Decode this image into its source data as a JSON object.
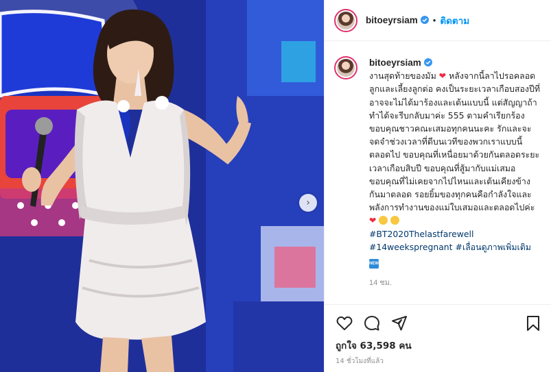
{
  "post": {
    "username": "bitoeyrsiam",
    "verified": true,
    "separator": "•",
    "follow_label": "ติดตาม"
  },
  "caption": {
    "username": "bitoeyrsiam",
    "text_1": "งานสุดท้ายของมัม",
    "heart": "❤",
    "text_2": "หลังจากนี้ลาไปรอคลอดลูกและเลี้ยงลูกต่อ คงเป็นระยะเวลาเกือบสองปีที่อาจจะไม่ได้มาร้องและเต้นแบบนี้ แต่สัญญาถ้าทำได้จะรีบกลับมาค่ะ 555 ตามคำเรียกร้อง ขอบคุณชาวคณะเสมอทุกคนนะคะ รักและจะจดจำช่วงเวลาที่ดีบนเวทีของพวกเราแบบนี้ตลอดไป ขอบคุณที่เหนื่อยมาด้วยกันตลอดระยะเวลาเกือบสิบปี ขอบคุณที่สู้มากับแม่เสมอ ขอบคุณที่ไม่เคยจากไปไหนและเต้นเคียงข้างกันมาตลอด รอยยิ้มของทุกคนคือกำลังใจและพลังการทำงานของแม่ใบเสมอและตลอดไปค่ะ",
    "hashtag_1": "#BT2020Thelastfarewell",
    "hashtag_2": "#14weekspregnant",
    "hashtag_3": "#เลื่อนดูภาพเพิ่มเติม",
    "new_emoji": "NEW",
    "time": "14 ชม."
  },
  "actions": {
    "likes_label": "ถูกใจ 63,598 คน",
    "posted_time": "14 ชั่วโมงที่แล้ว"
  },
  "photo": {
    "next_arrow": "›"
  },
  "icons": [
    "heart-outline-icon",
    "comment-icon",
    "share-icon",
    "bookmark-icon",
    "verified-badge-icon",
    "next-arrow-icon"
  ],
  "colors": {
    "accent_blue": "#0095f6",
    "hashtag": "#00376b",
    "verified": "#3897f0",
    "meta_gray": "#8e8e8e",
    "story_ring": "#e1306c"
  }
}
